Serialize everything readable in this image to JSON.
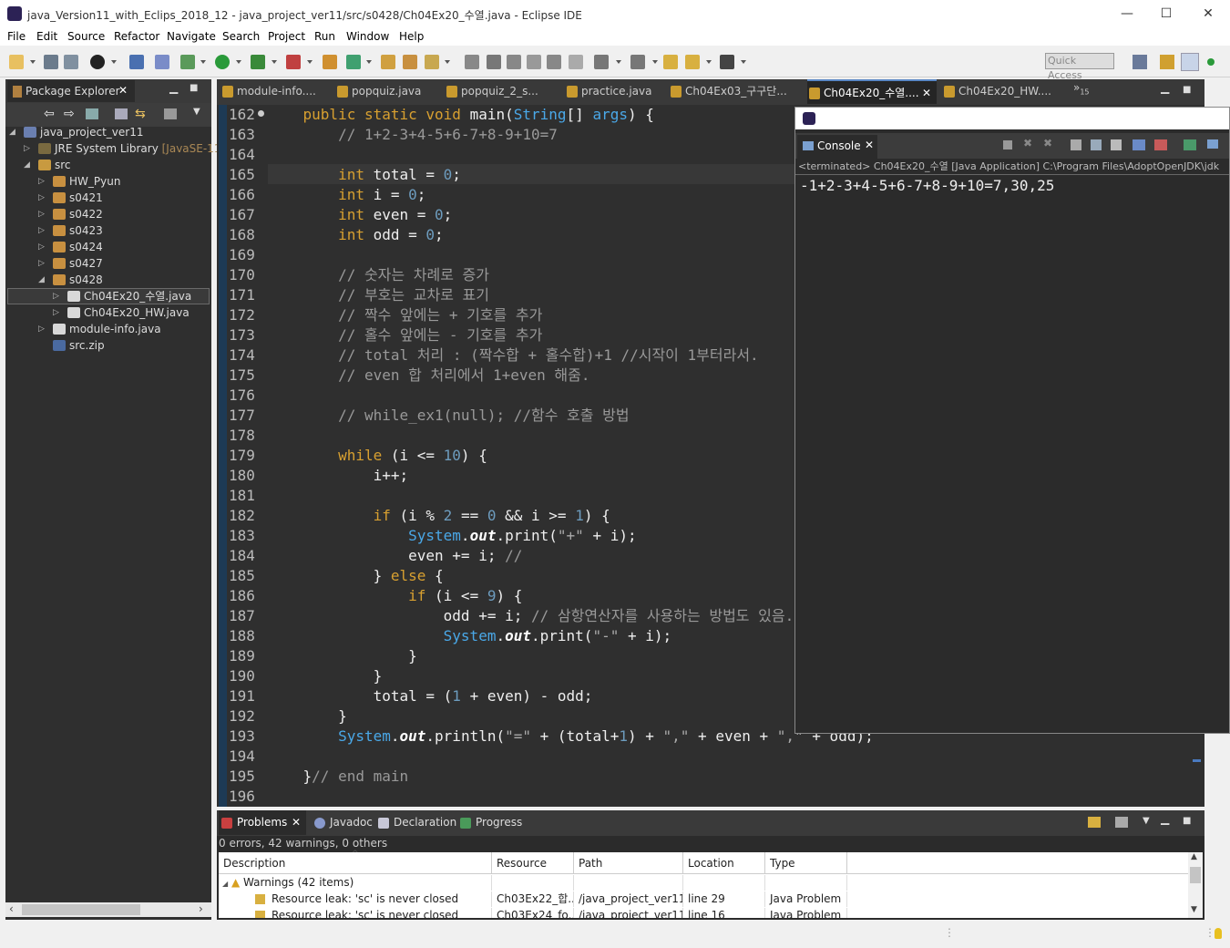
{
  "window": {
    "title": "java_Version11_with_Eclips_2018_12 - java_project_ver11/src/s0428/Ch04Ex20_수열.java - Eclipse IDE",
    "minimize": "—",
    "maximize": "☐",
    "close": "✕"
  },
  "menu": [
    "File",
    "Edit",
    "Source",
    "Refactor",
    "Navigate",
    "Search",
    "Project",
    "Run",
    "Window",
    "Help"
  ],
  "quick_access": "Quick Access",
  "package_explorer": {
    "tab": "Package Explorer",
    "tree": [
      {
        "label": "java_project_ver11",
        "depth": 0,
        "expanded": true,
        "icon": "project-icon"
      },
      {
        "label": "JRE System Library",
        "suffix": "[JavaSE-11]",
        "depth": 1,
        "expanded": false,
        "icon": "library-icon"
      },
      {
        "label": "src",
        "depth": 1,
        "expanded": true,
        "icon": "source-folder-icon"
      },
      {
        "label": "HW_Pyun",
        "depth": 2,
        "expanded": false,
        "icon": "package-icon"
      },
      {
        "label": "s0421",
        "depth": 2,
        "expanded": false,
        "icon": "package-icon"
      },
      {
        "label": "s0422",
        "depth": 2,
        "expanded": false,
        "icon": "package-icon"
      },
      {
        "label": "s0423",
        "depth": 2,
        "expanded": false,
        "icon": "package-icon"
      },
      {
        "label": "s0424",
        "depth": 2,
        "expanded": false,
        "icon": "package-icon"
      },
      {
        "label": "s0427",
        "depth": 2,
        "expanded": false,
        "icon": "package-icon"
      },
      {
        "label": "s0428",
        "depth": 2,
        "expanded": true,
        "icon": "package-icon"
      },
      {
        "label": "Ch04Ex20_수열.java",
        "depth": 3,
        "expanded": false,
        "icon": "java-file-icon",
        "selected": true
      },
      {
        "label": "Ch04Ex20_HW.java",
        "depth": 3,
        "expanded": false,
        "icon": "java-file-icon"
      },
      {
        "label": "module-info.java",
        "depth": 2,
        "expanded": false,
        "icon": "java-file-icon"
      },
      {
        "label": "src.zip",
        "depth": 2,
        "expanded": null,
        "icon": "zip-icon"
      }
    ]
  },
  "editor_tabs": [
    {
      "label": "module-info....",
      "active": false
    },
    {
      "label": "popquiz.java",
      "active": false
    },
    {
      "label": "popquiz_2_s...",
      "active": false
    },
    {
      "label": "practice.java",
      "active": false
    },
    {
      "label": "Ch04Ex03_구구단...",
      "active": false
    },
    {
      "label": "Ch04Ex20_수열....",
      "active": true
    },
    {
      "label": "Ch04Ex20_HW....",
      "active": false
    }
  ],
  "editor_overflow": "»",
  "editor_overflow_count": "15",
  "editor": {
    "lines": [
      {
        "n": "162",
        "t": [
          [
            "    ",
            ""
          ],
          [
            "public static void ",
            "kw"
          ],
          [
            "main(",
            ""
          ],
          [
            "String",
            "cls"
          ],
          [
            "[] ",
            ""
          ],
          [
            "args",
            "cls"
          ],
          [
            ") {",
            ""
          ]
        ]
      },
      {
        "n": "163",
        "t": [
          [
            "        // 1+2-3+4-5+6-7+8-9+10=7",
            "cm"
          ]
        ]
      },
      {
        "n": "164",
        "t": []
      },
      {
        "n": "165",
        "t": [
          [
            "        ",
            ""
          ],
          [
            "int ",
            "kw"
          ],
          [
            "total = ",
            ""
          ],
          [
            "0",
            "num"
          ],
          [
            ";",
            ""
          ]
        ]
      },
      {
        "n": "166",
        "t": [
          [
            "        ",
            ""
          ],
          [
            "int ",
            "kw"
          ],
          [
            "i = ",
            ""
          ],
          [
            "0",
            "num"
          ],
          [
            ";",
            ""
          ]
        ]
      },
      {
        "n": "167",
        "t": [
          [
            "        ",
            ""
          ],
          [
            "int ",
            "kw"
          ],
          [
            "even = ",
            ""
          ],
          [
            "0",
            "num"
          ],
          [
            ";",
            ""
          ]
        ]
      },
      {
        "n": "168",
        "t": [
          [
            "        ",
            ""
          ],
          [
            "int ",
            "kw"
          ],
          [
            "odd = ",
            ""
          ],
          [
            "0",
            "num"
          ],
          [
            ";",
            ""
          ]
        ]
      },
      {
        "n": "169",
        "t": []
      },
      {
        "n": "170",
        "t": [
          [
            "        // 숫자는 차례로 증가",
            "cm"
          ]
        ]
      },
      {
        "n": "171",
        "t": [
          [
            "        // 부호는 교차로 표기",
            "cm"
          ]
        ]
      },
      {
        "n": "172",
        "t": [
          [
            "        // 짝수 앞에는 + 기호를 추가",
            "cm"
          ]
        ]
      },
      {
        "n": "173",
        "t": [
          [
            "        // 홀수 앞에는 - 기호를 추가",
            "cm"
          ]
        ]
      },
      {
        "n": "174",
        "t": [
          [
            "        // total 처리 : (짝수합 + 홀수합)+1 //시작이 1부터라서.",
            "cm"
          ]
        ]
      },
      {
        "n": "175",
        "t": [
          [
            "        // even 합 처리에서 1+even 해줌.",
            "cm"
          ]
        ]
      },
      {
        "n": "176",
        "t": []
      },
      {
        "n": "177",
        "t": [
          [
            "        // while_ex1(null); //함수 호출 방법",
            "cm"
          ]
        ]
      },
      {
        "n": "178",
        "t": []
      },
      {
        "n": "179",
        "t": [
          [
            "        ",
            ""
          ],
          [
            "while ",
            "kw"
          ],
          [
            "(i <= ",
            ""
          ],
          [
            "10",
            "num"
          ],
          [
            ") {",
            ""
          ]
        ]
      },
      {
        "n": "180",
        "t": [
          [
            "            i++;",
            ""
          ]
        ]
      },
      {
        "n": "181",
        "t": []
      },
      {
        "n": "182",
        "t": [
          [
            "            ",
            ""
          ],
          [
            "if ",
            "kw"
          ],
          [
            "(i % ",
            ""
          ],
          [
            "2",
            "num"
          ],
          [
            " == ",
            ""
          ],
          [
            "0",
            "num"
          ],
          [
            " && i >= ",
            ""
          ],
          [
            "1",
            "num"
          ],
          [
            ") {",
            ""
          ]
        ]
      },
      {
        "n": "183",
        "t": [
          [
            "                ",
            ""
          ],
          [
            "System",
            "cls"
          ],
          [
            ".",
            ""
          ],
          [
            "out",
            "fld"
          ],
          [
            ".print(",
            ""
          ],
          [
            "\"+\"",
            "str"
          ],
          [
            " + i);",
            ""
          ]
        ]
      },
      {
        "n": "184",
        "t": [
          [
            "                even += i; ",
            ""
          ],
          [
            "//",
            "cm"
          ]
        ]
      },
      {
        "n": "185",
        "t": [
          [
            "            } ",
            ""
          ],
          [
            "else ",
            "kw"
          ],
          [
            "{",
            ""
          ]
        ]
      },
      {
        "n": "186",
        "t": [
          [
            "                ",
            ""
          ],
          [
            "if ",
            "kw"
          ],
          [
            "(i <= ",
            ""
          ],
          [
            "9",
            "num"
          ],
          [
            ") {",
            ""
          ]
        ]
      },
      {
        "n": "187",
        "t": [
          [
            "                    odd += i; ",
            ""
          ],
          [
            "// 삼항연산자를 사용하는 방법도 있음.",
            "cm"
          ]
        ]
      },
      {
        "n": "188",
        "t": [
          [
            "                    ",
            ""
          ],
          [
            "System",
            "cls"
          ],
          [
            ".",
            ""
          ],
          [
            "out",
            "fld"
          ],
          [
            ".print(",
            ""
          ],
          [
            "\"-\"",
            "str"
          ],
          [
            " + i);",
            ""
          ]
        ]
      },
      {
        "n": "189",
        "t": [
          [
            "                }",
            ""
          ]
        ]
      },
      {
        "n": "190",
        "t": [
          [
            "            }",
            ""
          ]
        ]
      },
      {
        "n": "191",
        "t": [
          [
            "            total = (",
            ""
          ],
          [
            "1",
            "num"
          ],
          [
            " + even) - odd;",
            ""
          ]
        ]
      },
      {
        "n": "192",
        "t": [
          [
            "        }",
            ""
          ]
        ]
      },
      {
        "n": "193",
        "t": [
          [
            "        ",
            ""
          ],
          [
            "System",
            "cls"
          ],
          [
            ".",
            ""
          ],
          [
            "out",
            "fld"
          ],
          [
            ".println(",
            ""
          ],
          [
            "\"=\"",
            "str"
          ],
          [
            " + (total+",
            ""
          ],
          [
            "1",
            "num"
          ],
          [
            ") + ",
            ""
          ],
          [
            "\",\"",
            "str"
          ],
          [
            " + even + ",
            ""
          ],
          [
            "\",\"",
            "str"
          ],
          [
            " + odd);",
            ""
          ]
        ]
      },
      {
        "n": "194",
        "t": []
      },
      {
        "n": "195",
        "t": [
          [
            "    }",
            ""
          ],
          [
            "// end main",
            "cm"
          ]
        ]
      },
      {
        "n": "196",
        "t": []
      }
    ]
  },
  "console": {
    "tab": "Console",
    "status": "<terminated> Ch04Ex20_수열 [Java Application] C:\\Program Files\\AdoptOpenJDK\\jdk",
    "output": "-1+2-3+4-5+6-7+8-9+10=7,30,25"
  },
  "problems": {
    "tabs": [
      {
        "label": "Problems",
        "active": true,
        "icon": "problems-icon"
      },
      {
        "label": "Javadoc",
        "active": false,
        "icon": "javadoc-icon"
      },
      {
        "label": "Declaration",
        "active": false,
        "icon": "declaration-icon"
      },
      {
        "label": "Progress",
        "active": false,
        "icon": "progress-icon"
      }
    ],
    "summary": "0 errors, 42 warnings, 0 others",
    "columns": [
      "Description",
      "Resource",
      "Path",
      "Location",
      "Type"
    ],
    "group": "Warnings (42 items)",
    "rows": [
      [
        "Resource leak: 'sc' is never closed",
        "Ch03Ex22_합...",
        "/java_project_ver11...",
        "line 29",
        "Java Problem"
      ],
      [
        "Resource leak: 'sc' is never closed",
        "Ch03Ex24_fo...",
        "/java_project_ver11...",
        "line 16",
        "Java Problem"
      ]
    ]
  },
  "colors": {
    "accent": "#5a88c5",
    "keyword": "#d8a030",
    "comment": "#999999",
    "number": "#6d9cbe",
    "class": "#4aa8e8",
    "editor_bg": "#2f2f2f"
  }
}
